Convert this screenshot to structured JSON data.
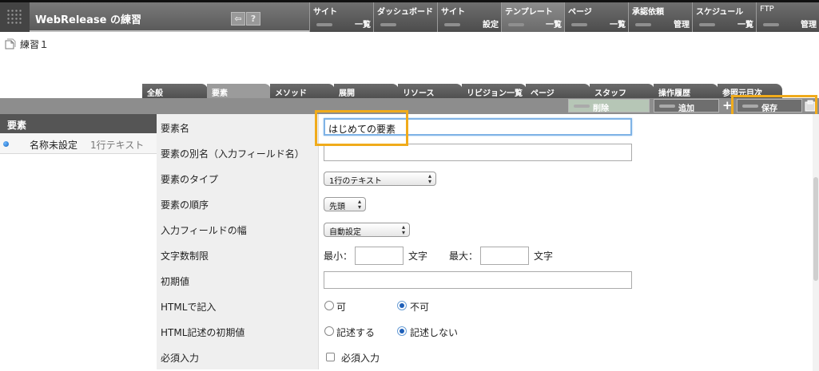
{
  "header": {
    "site_title": "WebRelease の練習",
    "help_label": "?"
  },
  "nav": [
    {
      "label": "サイト",
      "sub": "一覧"
    },
    {
      "label": "ダッシュボード",
      "sub": ""
    },
    {
      "label": "サイト",
      "sub": "設定"
    },
    {
      "label": "テンプレート",
      "sub": "一覧",
      "active": true
    },
    {
      "label": "ページ",
      "sub": "一覧"
    },
    {
      "label": "承認依頼",
      "sub": "管理"
    },
    {
      "label": "スケジュール",
      "sub": "一覧"
    },
    {
      "label": "FTP",
      "sub": "管理"
    }
  ],
  "breadcrumb": {
    "label": "練習１"
  },
  "tabs": [
    {
      "label": "全般"
    },
    {
      "label": "要素",
      "active": true
    },
    {
      "label": "メソッド"
    },
    {
      "label": "展開"
    },
    {
      "label": "リソース"
    },
    {
      "label": "リビジョン一覧"
    },
    {
      "label": "ページ"
    },
    {
      "label": "スタッフ"
    },
    {
      "label": "操作履歴"
    },
    {
      "label": "参照元目次"
    }
  ],
  "toolbar": {
    "delete_label": "削除",
    "add_label": "追加",
    "add_symbol": "+",
    "save_label": "保存"
  },
  "sidebar": {
    "title": "要素",
    "item_name": "名称未設定",
    "item_type": "1行テキスト"
  },
  "form": {
    "name_label": "要素名",
    "name_value": "はじめての要素",
    "alias_label": "要素の別名（入力フィールド名）",
    "alias_value": "",
    "type_label": "要素のタイプ",
    "type_value": "1行のテキスト",
    "order_label": "要素の順序",
    "order_value": "先頭",
    "width_label": "入力フィールドの幅",
    "width_value": "自動設定",
    "limit_label": "文字数制限",
    "min_label": "最小：",
    "max_label": "最大：",
    "unit_label": "文字",
    "initial_label": "初期値",
    "html_label": "HTMLで記入",
    "html_yes": "可",
    "html_no": "不可",
    "html_init_label": "HTML記述の初期値",
    "html_init_yes": "記述する",
    "html_init_no": "記述しない",
    "required_label": "必須入力",
    "required_checkbox": "必須入力"
  },
  "colors": {
    "highlight": "#f0ab1b",
    "nav_bg": "#5a5a5a",
    "focus_border": "#7fb3e6"
  }
}
